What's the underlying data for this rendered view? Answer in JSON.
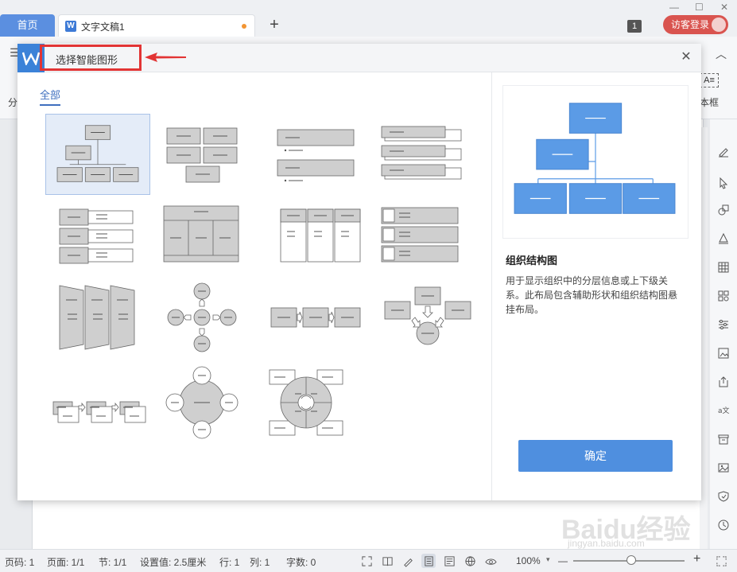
{
  "tabs": {
    "home_label": "首页",
    "doc_label": "文字文稿1",
    "new_tab_symbol": "+",
    "window_badge": "1",
    "login_label": "访客登录"
  },
  "ribbon": {
    "left_label": "分",
    "textbox_icon_text": "A≡",
    "textbox_label": "本框"
  },
  "dialog": {
    "title": "选择智能图形",
    "close_symbol": "✕",
    "category_tab": "全部",
    "selected_title": "组织结构图",
    "selected_description": "用于显示组织中的分层信息或上下级关系。此布局包含辅助形状和组织结构图悬挂布局。",
    "confirm_label": "确定",
    "thumbnails": [
      "org-chart",
      "block-grid",
      "bullet-blocks",
      "stacked-tabs",
      "label-list",
      "table-layout",
      "column-layout",
      "icon-list",
      "funnel-panels",
      "radial-cross",
      "process-arrows",
      "converge-circle",
      "staggered-process",
      "radial-circle",
      "quadrant-cycle"
    ]
  },
  "status": {
    "page_code": "页码: 1",
    "page_of": "页面: 1/1",
    "section": "节: 1/1",
    "setting": "设置值: 2.5厘米",
    "row": "行: 1",
    "col": "列: 1",
    "word_count": "字数: 0",
    "zoom": "100%",
    "zoom_minus": "—",
    "zoom_plus": "+"
  },
  "watermark": {
    "brand": "Baidu经验",
    "url": "jingyan.baidu.com"
  },
  "colors": {
    "accent": "#4f8fdf",
    "home_tab": "#5b8fe0",
    "login_button": "#d9544f",
    "highlight_red": "#e23434",
    "preview_blue": "#5b9be6"
  }
}
